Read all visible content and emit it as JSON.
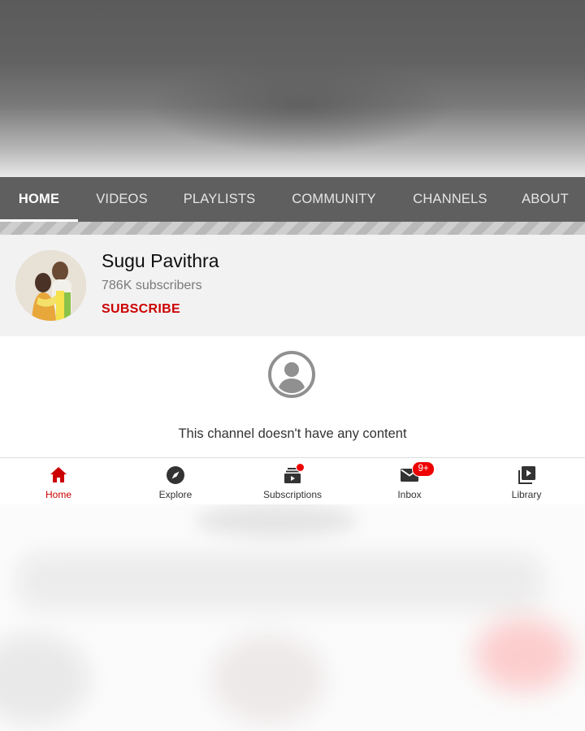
{
  "tabs": [
    {
      "label": "HOME",
      "active": true
    },
    {
      "label": "VIDEOS",
      "active": false
    },
    {
      "label": "PLAYLISTS",
      "active": false
    },
    {
      "label": "COMMUNITY",
      "active": false
    },
    {
      "label": "CHANNELS",
      "active": false
    },
    {
      "label": "ABOUT",
      "active": false
    }
  ],
  "channel": {
    "name": "Sugu Pavithra",
    "subscribers": "786K subscribers",
    "subscribe_label": "SUBSCRIBE"
  },
  "empty_state": {
    "icon": "account-circle-icon",
    "message": "This channel doesn't have any content"
  },
  "bottom_nav": [
    {
      "label": "Home",
      "icon": "home-icon",
      "active": true
    },
    {
      "label": "Explore",
      "icon": "compass-icon",
      "active": false
    },
    {
      "label": "Subscriptions",
      "icon": "subscriptions-icon",
      "active": false,
      "dot": true
    },
    {
      "label": "Inbox",
      "icon": "mail-icon",
      "active": false,
      "badge": "9+"
    },
    {
      "label": "Library",
      "icon": "library-icon",
      "active": false
    }
  ],
  "colors": {
    "accent": "#cc0000",
    "tab_bar": "#5f5f5f",
    "header_bg": "#f2f2f2"
  }
}
